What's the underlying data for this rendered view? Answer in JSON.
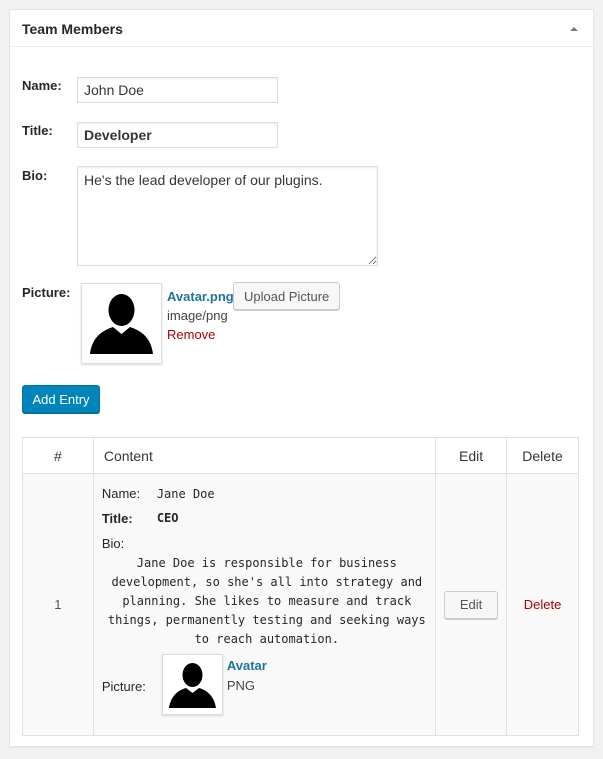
{
  "panel": {
    "title": "Team Members",
    "toggle_icon": "arrow-up-icon"
  },
  "form": {
    "name_label": "Name:",
    "name_value": "John Doe",
    "title_label": "Title:",
    "title_value": "Developer",
    "bio_label": "Bio:",
    "bio_value": "He's the lead developer of our plugins.",
    "picture_label": "Picture:",
    "picture": {
      "file_name": "Avatar.png",
      "mime_type": "image/png",
      "remove_label": "Remove",
      "upload_button": "Upload Picture"
    },
    "add_entry_button": "Add Entry"
  },
  "table": {
    "headers": [
      "#",
      "Content",
      "Edit",
      "Delete"
    ],
    "rows": [
      {
        "index": "1",
        "name_label": "Name:",
        "name": "Jane Doe",
        "title_label": "Title:",
        "title": "CEO",
        "bio_label": "Bio:",
        "bio": "Jane Doe is responsible for business development, so she's all into strategy and planning. She likes to measure and track things, permanently testing and seeking ways to reach automation.",
        "picture_label": "Picture:",
        "picture_name": "Avatar",
        "picture_type": "PNG",
        "edit_button": "Edit",
        "delete_link": "Delete"
      }
    ]
  },
  "colors": {
    "primary_button": "#0085ba",
    "link": "#21759b",
    "danger": "#a00"
  }
}
